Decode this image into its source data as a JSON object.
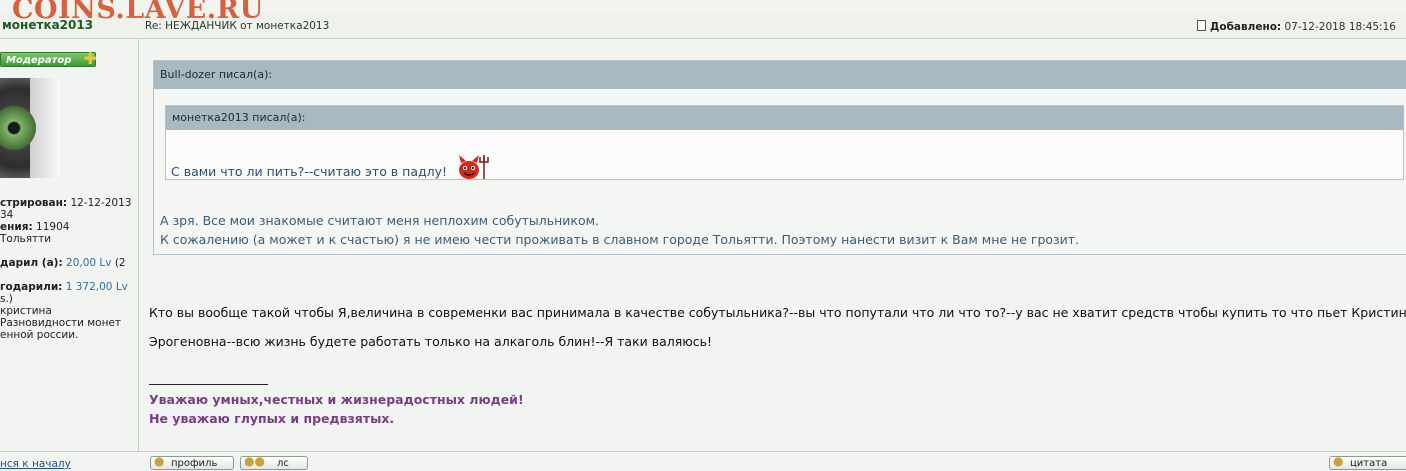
{
  "watermark": "COINS.LAVE.RU",
  "header": {
    "username": "монетка2013",
    "subject": "Re: НЕЖДАНЧИК от монетка2013",
    "date_label": "Добавлено:",
    "date_value": "07-12-2018 18:45:16"
  },
  "sidebar": {
    "badge": "Модератор",
    "registered_label": "стрирован:",
    "registered_value": "12-12-2013",
    "line2": "34",
    "posts_label": "ения:",
    "posts_value": "11904",
    "city": "Тольятти",
    "gifted_label": "дарил (а):",
    "gifted_value": "20,00 Lv",
    "gifted_suffix": "(2",
    "thanked_label": "годарили:",
    "thanked_value": "1 372,00 Lv",
    "extra1": "s.)",
    "extra2": "кристина",
    "extra3": "Разновидности монет",
    "extra4": "енной россии."
  },
  "post": {
    "outer_quote_header": "Bull-dozer писал(а):",
    "inner_quote_header": "монетка2013 писал(а):",
    "inner_quote_text": "С вами что ли пить?--считаю это в падлу!",
    "reply_line1": "А зря. Все мои знакомые считают меня неплохим собутыльником.",
    "reply_line2": "К сожалению (а может и к счастью) я не имею чести проживать в славном городе Тольятти. Поэтому нанести визит к Вам мне не грозит.",
    "body_line1": "Кто вы вообще такой чтобы Я,величина в современки вас принимала в качестве собутыльника?--вы что попутали что ли что то?--у вас не хватит средств чтобы купить то что пьет Кристина",
    "body_line2": "Эрогеновна--всю жизнь будете работать только на алкаголь блин!--Я таки валяюсь!",
    "signature_line1": "Уважаю умных,честных и жизнерадостных людей!",
    "signature_line2": "Не уважаю глупых и предвзятых."
  },
  "footer": {
    "back_link": "нся к началу",
    "profile_button": "профиль",
    "pm_button": "лс",
    "quote_button": "цитата"
  },
  "colors": {
    "quote_header_bg": "#a9b9c2",
    "signature": "#7a3d88",
    "username": "#1f5a24",
    "watermark": "#d9603f"
  }
}
